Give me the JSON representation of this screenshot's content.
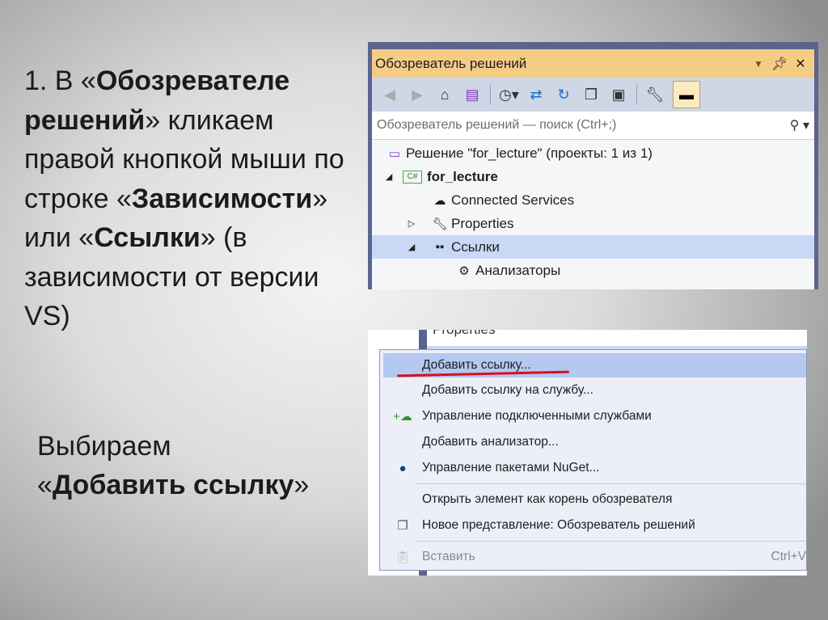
{
  "slide": {
    "para1": {
      "t1": "1. В «",
      "b1": "Обозревателе решений",
      "t2": "» кликаем правой кнопкой мыши по строке «",
      "b2": "Зависимости",
      "t3": "» или «",
      "b3": "Ссылки",
      "t4": "» (в зависимости от версии VS)"
    },
    "para2": {
      "t1": "Выбираем",
      "t2": "«",
      "b1": "Добавить ссылку",
      "t3": "»"
    }
  },
  "solution_explorer": {
    "title": "Обозреватель решений",
    "search_placeholder": "Обозреватель решений — поиск (Ctrl+;)",
    "tree": [
      {
        "label": "Решение \"for_lecture\" (проекты: 1 из 1)"
      },
      {
        "label": "for_lecture"
      },
      {
        "label": "Connected Services"
      },
      {
        "label": "Properties"
      },
      {
        "label": "Ссылки"
      },
      {
        "label": "Анализаторы"
      }
    ]
  },
  "context_menu": {
    "ghost_label": "Properties",
    "items": [
      {
        "label": "Добавить ссылку..."
      },
      {
        "label": "Добавить ссылку на службу..."
      },
      {
        "label": "Управление подключенными службами"
      },
      {
        "label": "Добавить анализатор..."
      },
      {
        "label": "Управление пакетами NuGet..."
      },
      {
        "label": "Открыть элемент как корень обозревателя"
      },
      {
        "label": "Новое представление: Обозреватель решений"
      },
      {
        "label": "Вставить",
        "shortcut": "Ctrl+V"
      }
    ]
  },
  "colors": {
    "title_bar": "#f5cc84",
    "selection": "#c9d8f5",
    "menu_highlight": "#b4c8f0",
    "underline": "#d8101a"
  }
}
